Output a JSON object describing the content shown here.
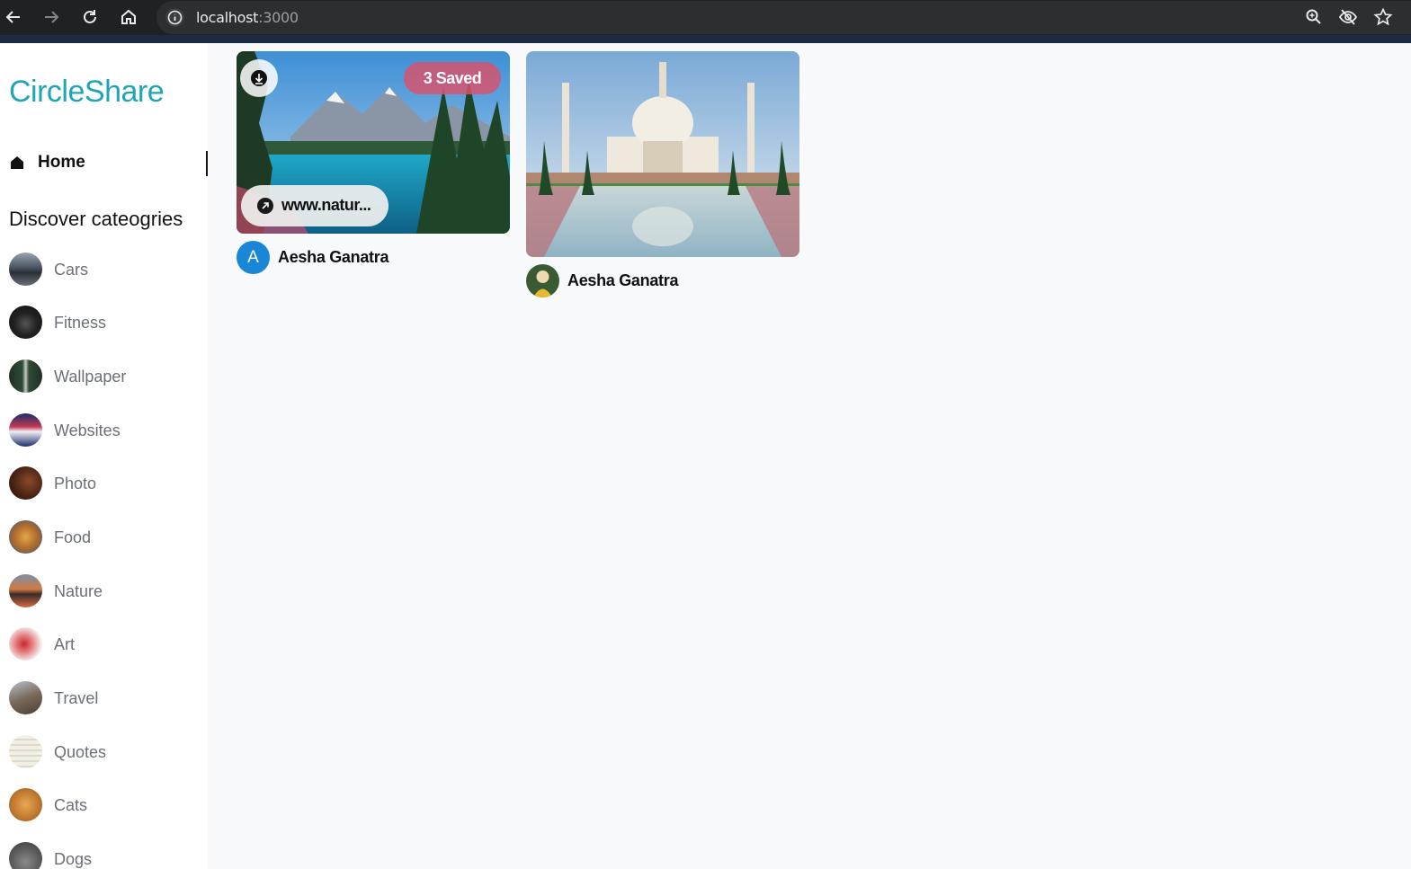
{
  "browser": {
    "url_host": "localhost",
    "url_port": ":3000",
    "nav_icons": [
      "back-arrow-icon",
      "forward-arrow-icon",
      "reload-icon",
      "home-icon"
    ],
    "right_icons": [
      "zoom-icon",
      "eye-off-icon",
      "star-icon"
    ]
  },
  "sidebar": {
    "logo": "CircleShare",
    "home_label": "Home",
    "discover_heading": "Discover cateogries",
    "categories": [
      {
        "label": "Cars"
      },
      {
        "label": "Fitness"
      },
      {
        "label": "Wallpaper"
      },
      {
        "label": "Websites"
      },
      {
        "label": "Photo"
      },
      {
        "label": "Food"
      },
      {
        "label": "Nature"
      },
      {
        "label": "Art"
      },
      {
        "label": "Travel"
      },
      {
        "label": "Quotes"
      },
      {
        "label": "Cats"
      },
      {
        "label": "Dogs"
      }
    ]
  },
  "pins": [
    {
      "saved_label": "3 Saved",
      "link_label": "www.natur...",
      "author_initial": "A",
      "author_name": "Aesha Ganatra"
    },
    {
      "author_name": "Aesha Ganatra"
    }
  ],
  "colors": {
    "brand": "#1fa6b6",
    "saved_badge": "#d6546e",
    "avatar_bg": "#1a86d6"
  }
}
